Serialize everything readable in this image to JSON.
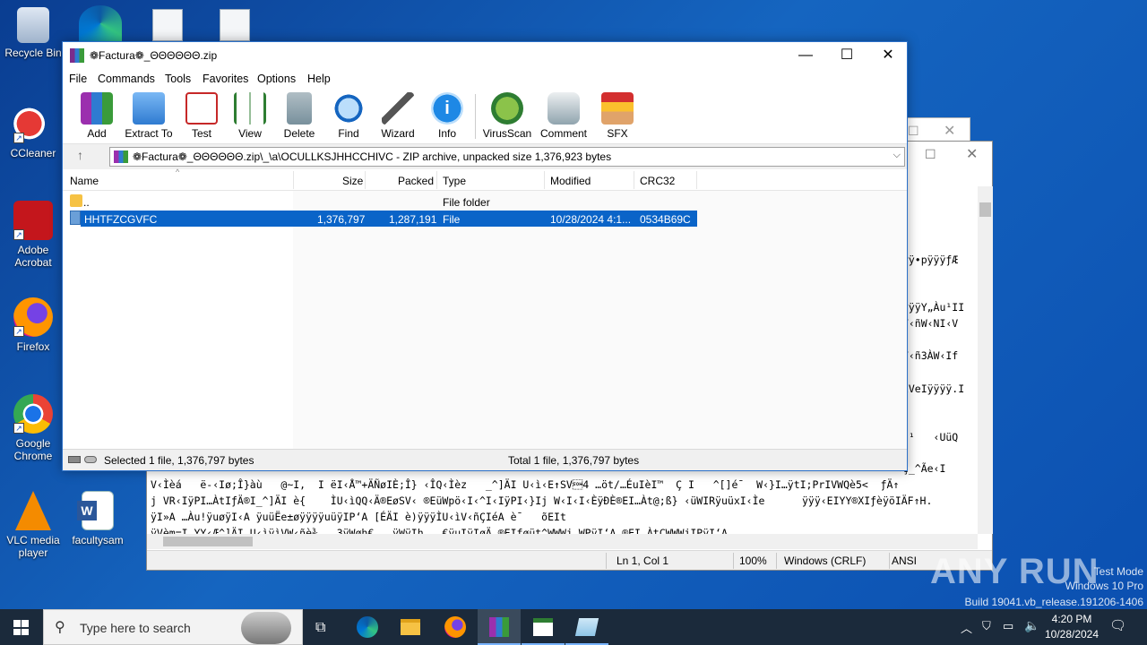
{
  "desktop": {
    "icons": [
      {
        "label": "Recycle Bin"
      },
      {
        "label": "CCleaner"
      },
      {
        "label": "Adobe Acrobat"
      },
      {
        "label": "Firefox"
      },
      {
        "label": "Google Chrome"
      },
      {
        "label": "VLC media player"
      },
      {
        "label": "facultysam"
      }
    ]
  },
  "notepad": {
    "lines": [
      "ýPÿ•pÿÿÿƒÆ",
      "’ÿÿÿY„Àu¹II",
      "§V‹ñW‹NI‹V",
      "ÍV‹ñ3ÀW‹If",
      "‹ËVeIÿÿÿÿ.I",
      "éI¹   ‹UüQ",
      "‹Ç_^Ãe‹I",
      "V‹Ìèá   ë-‹Iø;Î}àù   @~I,  I ëI‹Å™+ÄÑøIÈ;Î} ‹ÎQ‹Ìèz   _^]ÄI U‹ì‹E↑SV\u00014 …öt/…ÉuIèI™  Ç I   ^[]é¯  W‹}I…ÿtI;PrIVWQè5<  ƒÄ↑",
      "j VR‹IÿPI…ÀtIƒÄ®I_^]ÄI è{    ÌU‹ìQQ‹Ä®EøSV‹ ®EüWpö‹I‹^I‹IÿPI‹}Ij W‹I‹I‹ÈÿÐÈ®EI…Àt@;ß} ‹üWIRÿuüxI‹Ìe      ÿÿÿ‹EIYY®XIƒèÿöIÄF↑H.",
      "ÿI»A …Àu!ÿuøÿI‹A ÿuüËe±øÿÿÿÿuüÿIP‘A [ÉÄI è)ÿÿÿÌU‹ìV‹ñÇIéA è¯   õEIt",
      "ÿVèm=I YY‹Æ^]ÄI U‹ìÿìVW‹ñè¾   3ÿWøh€   ÿWÿIh   €ÿuIÿIøÄ ®EIføüt^WWWj WPÿI‘A ®EI ÀtÇWWWjIPÿI‘A"
    ],
    "status": {
      "position": "Ln 1, Col 1",
      "zoom": "100%",
      "eol": "Windows (CRLF)",
      "encoding": "ANSI"
    }
  },
  "winrar": {
    "title": "❁Factura❁_ΘΘΘΘΘΘ.zip",
    "menu": [
      "File",
      "Commands",
      "Tools",
      "Favorites",
      "Options",
      "Help"
    ],
    "toolbar": [
      {
        "label": "Add",
        "icon": "add-icon"
      },
      {
        "label": "Extract To",
        "icon": "extract-icon"
      },
      {
        "label": "Test",
        "icon": "test-icon"
      },
      {
        "label": "View",
        "icon": "view-icon"
      },
      {
        "label": "Delete",
        "icon": "delete-icon"
      },
      {
        "label": "Find",
        "icon": "find-icon"
      },
      {
        "label": "Wizard",
        "icon": "wizard-icon"
      },
      {
        "label": "Info",
        "icon": "info-icon"
      },
      {
        "label": "VirusScan",
        "icon": "virusscan-icon"
      },
      {
        "label": "Comment",
        "icon": "comment-icon"
      },
      {
        "label": "SFX",
        "icon": "sfx-icon"
      }
    ],
    "address": "❁Factura❁_ΘΘΘΘΘΘ.zip\\_\\a\\OCULLKSJHHCCHIVC - ZIP archive, unpacked size 1,376,923 bytes",
    "columns": [
      "Name",
      "Size",
      "Packed",
      "Type",
      "Modified",
      "CRC32"
    ],
    "rows": [
      {
        "name": "..",
        "size": "",
        "packed": "",
        "type": "File folder",
        "modified": "",
        "crc": ""
      },
      {
        "name": "HHTFZCGVFC",
        "size": "1,376,797",
        "packed": "1,287,191",
        "type": "File",
        "modified": "10/28/2024 4:1...",
        "crc": "0534B69C"
      }
    ],
    "status_left": "Selected 1 file, 1,376,797 bytes",
    "status_right": "Total 1 file, 1,376,797 bytes"
  },
  "taskbar": {
    "search_placeholder": "Type here to search",
    "time": "4:20 PM",
    "date": "10/28/2024"
  },
  "watermark": {
    "brand": "ANY RUN",
    "line1": "Test Mode",
    "line2": "Windows 10 Pro",
    "line3": "Build 19041.vb_release.191206-1406"
  },
  "colors": {
    "selection": "#0a64c8",
    "taskbar": "#1b2a3b",
    "accent": "#2b70c9"
  }
}
